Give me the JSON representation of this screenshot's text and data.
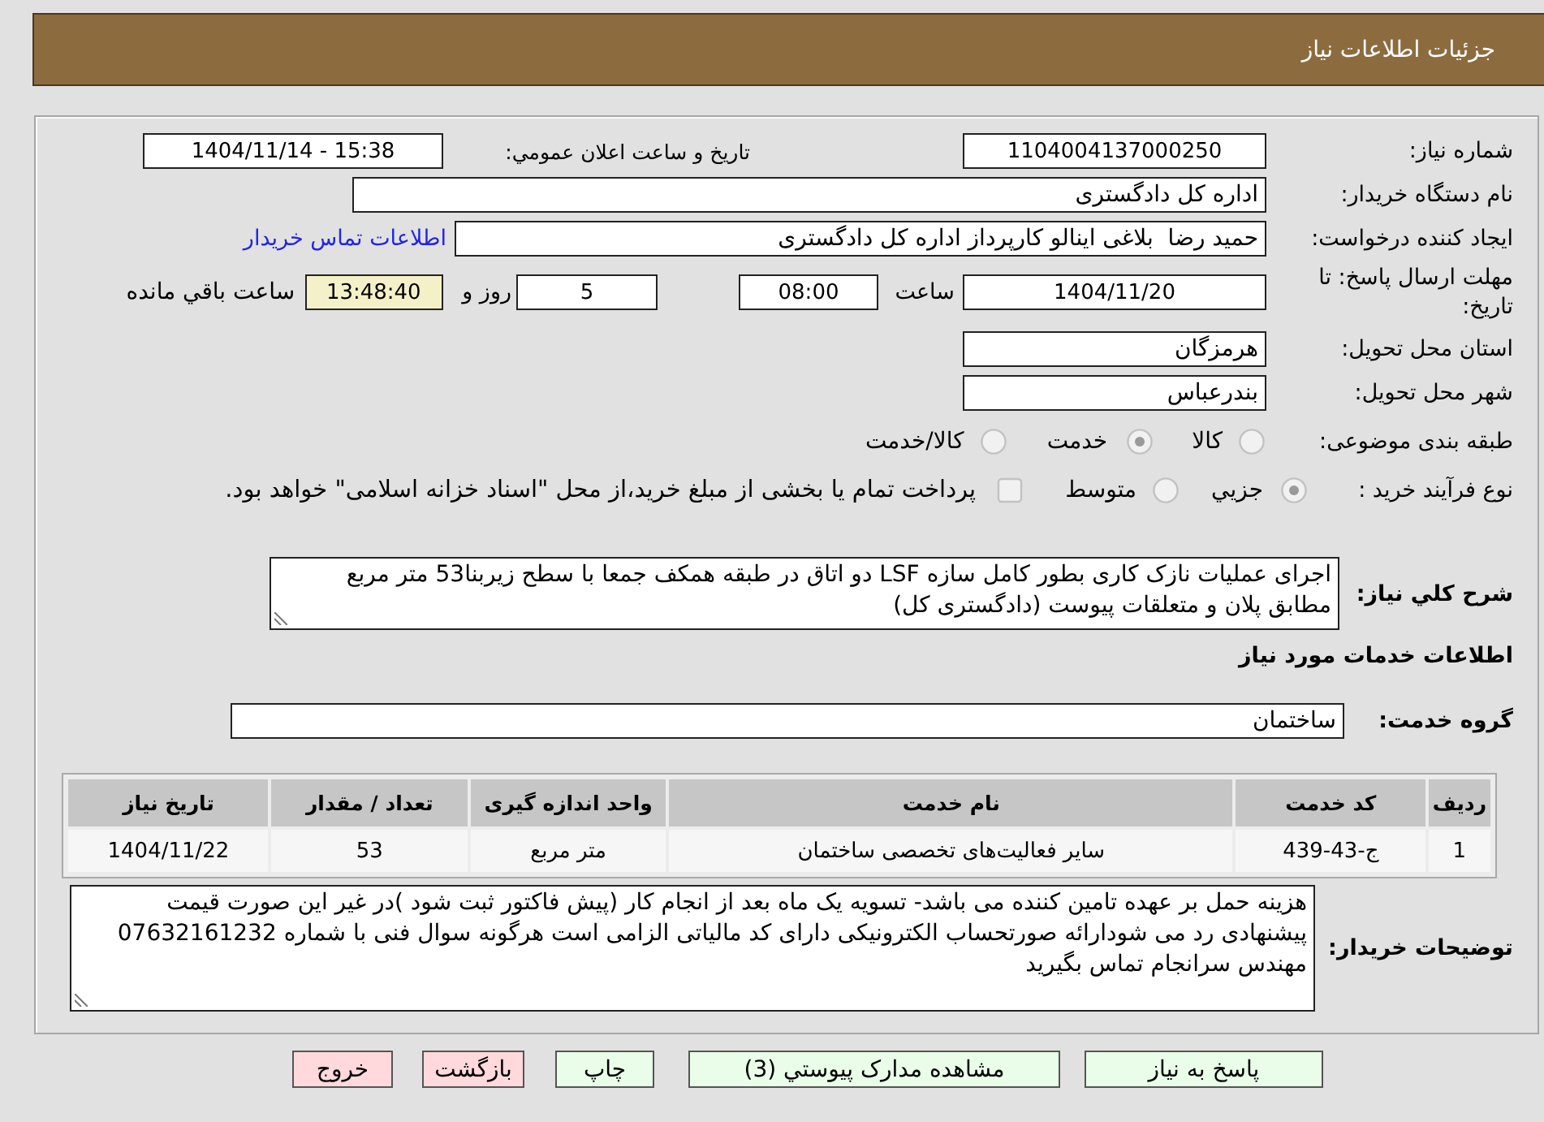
{
  "header": {
    "title": "جزئیات اطلاعات نیاز"
  },
  "form": {
    "need_number": {
      "label": "شماره نیاز:",
      "value": "1104004137000250"
    },
    "announce_datetime": {
      "label": "تاريخ و ساعت اعلان عمومي:",
      "value": "1404/11/14 - 15:38"
    },
    "buyer_org": {
      "label": "نام دستگاه خریدار:",
      "value": "اداره کل دادگستری"
    },
    "requester": {
      "label": "ایجاد کننده درخواست:",
      "value": "حمید رضا  بلاغی اینالو کارپرداز اداره کل دادگستری",
      "link": "اطلاعات تماس خریدار"
    },
    "deadline": {
      "label": "مهلت ارسال پاسخ: تا تاریخ:",
      "date": "1404/11/20",
      "time_label": "ساعت",
      "time": "08:00",
      "days": "5",
      "days_label": "روز و",
      "remaining": "13:48:40",
      "remaining_label": "ساعت باقي مانده"
    },
    "province": {
      "label": "استان محل تحویل:",
      "value": "هرمزگان"
    },
    "city": {
      "label": "شهر محل تحویل:",
      "value": "بندرعباس"
    },
    "category": {
      "label": "طبقه بندی موضوعی:",
      "options": [
        {
          "label": "کالا",
          "selected": false
        },
        {
          "label": "خدمت",
          "selected": true
        },
        {
          "label": "کالا/خدمت",
          "selected": false
        }
      ]
    },
    "process": {
      "label": "نوع فرآیند خرید :",
      "options": [
        {
          "label": "جزيي",
          "selected": true
        },
        {
          "label": "متوسط",
          "selected": false
        }
      ],
      "treasury": {
        "label": "پرداخت تمام یا بخشی از مبلغ خرید،از محل \"اسناد خزانه اسلامی\" خواهد بود.",
        "checked": false
      }
    }
  },
  "description": {
    "label": "شرح کلي نياز:",
    "value": "اجرای عملیات نازک کاری بطور کامل سازه LSF دو اتاق در طبقه همکف جمعا با سطح زیربنا53 متر مربع مطابق پلان و متعلقات پیوست (دادگستری کل)"
  },
  "services": {
    "title": "اطلاعات خدمات مورد نیاز",
    "group_label": "گروه خدمت:",
    "group": "ساختمان",
    "table": {
      "columns": [
        "ردیف",
        "کد خدمت",
        "نام خدمت",
        "واحد اندازه گیری",
        "تعداد / مقدار",
        "تاریخ نیاز"
      ],
      "rows": [
        [
          "1",
          "ج-43-439",
          "سایر فعالیت‌های تخصصی ساختمان",
          "متر مربع",
          "53",
          "1404/11/22"
        ]
      ]
    }
  },
  "notes": {
    "label": "توضیحات خریدار:",
    "value": "هزینه حمل بر عهده تامین کننده می باشد- تسویه یک ماه بعد از انجام کار  (پیش فاکتور ثبت شود )در غیر این صورت قیمت پیشنهادی رد می شودارائه صورتحساب الکترونیکی دارای کد مالیاتی الزامی است هرگونه سوال فنی با شماره 07632161232 مهندس سرانجام تماس بگیرید"
  },
  "buttons": [
    {
      "label": "پاسخ به نیاز",
      "kind": "normal"
    },
    {
      "label": "مشاهده مدارک پیوستي (3)",
      "kind": "normal"
    },
    {
      "label": "چاپ",
      "kind": "normal"
    },
    {
      "label": "بازگشت",
      "kind": "cancel"
    },
    {
      "label": "خروج",
      "kind": "cancel"
    }
  ]
}
